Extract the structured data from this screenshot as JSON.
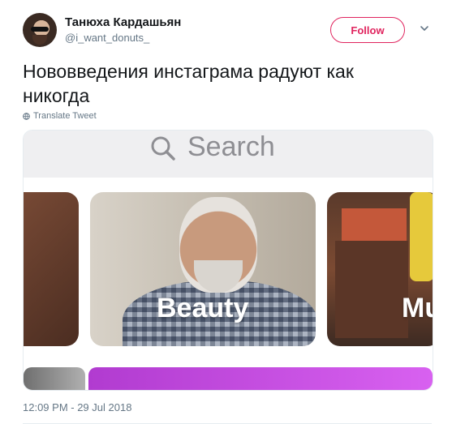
{
  "tweet": {
    "author_name": "Танюха Кардашьян",
    "handle": "@i_want_donuts_",
    "follow_label": "Follow",
    "text": "Нововведения инстаграма радуют как никогда",
    "translate_label": "Translate Tweet",
    "timestamp": "12:09 PM - 29 Jul 2018",
    "follow_color": "#e0245e"
  },
  "media": {
    "search_placeholder": "Search",
    "tiles": [
      {
        "label": ""
      },
      {
        "label": "Beauty"
      },
      {
        "label": "Mu"
      }
    ]
  },
  "icons": {
    "chevron": "chevron-down-icon",
    "globe": "globe-icon",
    "search": "search-icon"
  }
}
